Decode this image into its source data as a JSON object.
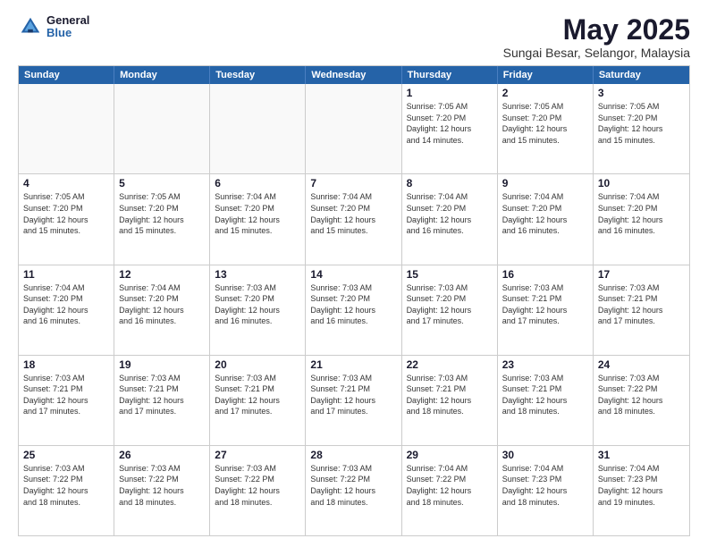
{
  "logo": {
    "general": "General",
    "blue": "Blue"
  },
  "header": {
    "title": "May 2025",
    "subtitle": "Sungai Besar, Selangor, Malaysia"
  },
  "days": [
    "Sunday",
    "Monday",
    "Tuesday",
    "Wednesday",
    "Thursday",
    "Friday",
    "Saturday"
  ],
  "weeks": [
    [
      {
        "day": "",
        "content": ""
      },
      {
        "day": "",
        "content": ""
      },
      {
        "day": "",
        "content": ""
      },
      {
        "day": "",
        "content": ""
      },
      {
        "day": "1",
        "content": "Sunrise: 7:05 AM\nSunset: 7:20 PM\nDaylight: 12 hours\nand 14 minutes."
      },
      {
        "day": "2",
        "content": "Sunrise: 7:05 AM\nSunset: 7:20 PM\nDaylight: 12 hours\nand 15 minutes."
      },
      {
        "day": "3",
        "content": "Sunrise: 7:05 AM\nSunset: 7:20 PM\nDaylight: 12 hours\nand 15 minutes."
      }
    ],
    [
      {
        "day": "4",
        "content": "Sunrise: 7:05 AM\nSunset: 7:20 PM\nDaylight: 12 hours\nand 15 minutes."
      },
      {
        "day": "5",
        "content": "Sunrise: 7:05 AM\nSunset: 7:20 PM\nDaylight: 12 hours\nand 15 minutes."
      },
      {
        "day": "6",
        "content": "Sunrise: 7:04 AM\nSunset: 7:20 PM\nDaylight: 12 hours\nand 15 minutes."
      },
      {
        "day": "7",
        "content": "Sunrise: 7:04 AM\nSunset: 7:20 PM\nDaylight: 12 hours\nand 15 minutes."
      },
      {
        "day": "8",
        "content": "Sunrise: 7:04 AM\nSunset: 7:20 PM\nDaylight: 12 hours\nand 16 minutes."
      },
      {
        "day": "9",
        "content": "Sunrise: 7:04 AM\nSunset: 7:20 PM\nDaylight: 12 hours\nand 16 minutes."
      },
      {
        "day": "10",
        "content": "Sunrise: 7:04 AM\nSunset: 7:20 PM\nDaylight: 12 hours\nand 16 minutes."
      }
    ],
    [
      {
        "day": "11",
        "content": "Sunrise: 7:04 AM\nSunset: 7:20 PM\nDaylight: 12 hours\nand 16 minutes."
      },
      {
        "day": "12",
        "content": "Sunrise: 7:04 AM\nSunset: 7:20 PM\nDaylight: 12 hours\nand 16 minutes."
      },
      {
        "day": "13",
        "content": "Sunrise: 7:03 AM\nSunset: 7:20 PM\nDaylight: 12 hours\nand 16 minutes."
      },
      {
        "day": "14",
        "content": "Sunrise: 7:03 AM\nSunset: 7:20 PM\nDaylight: 12 hours\nand 16 minutes."
      },
      {
        "day": "15",
        "content": "Sunrise: 7:03 AM\nSunset: 7:20 PM\nDaylight: 12 hours\nand 17 minutes."
      },
      {
        "day": "16",
        "content": "Sunrise: 7:03 AM\nSunset: 7:21 PM\nDaylight: 12 hours\nand 17 minutes."
      },
      {
        "day": "17",
        "content": "Sunrise: 7:03 AM\nSunset: 7:21 PM\nDaylight: 12 hours\nand 17 minutes."
      }
    ],
    [
      {
        "day": "18",
        "content": "Sunrise: 7:03 AM\nSunset: 7:21 PM\nDaylight: 12 hours\nand 17 minutes."
      },
      {
        "day": "19",
        "content": "Sunrise: 7:03 AM\nSunset: 7:21 PM\nDaylight: 12 hours\nand 17 minutes."
      },
      {
        "day": "20",
        "content": "Sunrise: 7:03 AM\nSunset: 7:21 PM\nDaylight: 12 hours\nand 17 minutes."
      },
      {
        "day": "21",
        "content": "Sunrise: 7:03 AM\nSunset: 7:21 PM\nDaylight: 12 hours\nand 17 minutes."
      },
      {
        "day": "22",
        "content": "Sunrise: 7:03 AM\nSunset: 7:21 PM\nDaylight: 12 hours\nand 18 minutes."
      },
      {
        "day": "23",
        "content": "Sunrise: 7:03 AM\nSunset: 7:21 PM\nDaylight: 12 hours\nand 18 minutes."
      },
      {
        "day": "24",
        "content": "Sunrise: 7:03 AM\nSunset: 7:22 PM\nDaylight: 12 hours\nand 18 minutes."
      }
    ],
    [
      {
        "day": "25",
        "content": "Sunrise: 7:03 AM\nSunset: 7:22 PM\nDaylight: 12 hours\nand 18 minutes."
      },
      {
        "day": "26",
        "content": "Sunrise: 7:03 AM\nSunset: 7:22 PM\nDaylight: 12 hours\nand 18 minutes."
      },
      {
        "day": "27",
        "content": "Sunrise: 7:03 AM\nSunset: 7:22 PM\nDaylight: 12 hours\nand 18 minutes."
      },
      {
        "day": "28",
        "content": "Sunrise: 7:03 AM\nSunset: 7:22 PM\nDaylight: 12 hours\nand 18 minutes."
      },
      {
        "day": "29",
        "content": "Sunrise: 7:04 AM\nSunset: 7:22 PM\nDaylight: 12 hours\nand 18 minutes."
      },
      {
        "day": "30",
        "content": "Sunrise: 7:04 AM\nSunset: 7:23 PM\nDaylight: 12 hours\nand 18 minutes."
      },
      {
        "day": "31",
        "content": "Sunrise: 7:04 AM\nSunset: 7:23 PM\nDaylight: 12 hours\nand 19 minutes."
      }
    ]
  ]
}
